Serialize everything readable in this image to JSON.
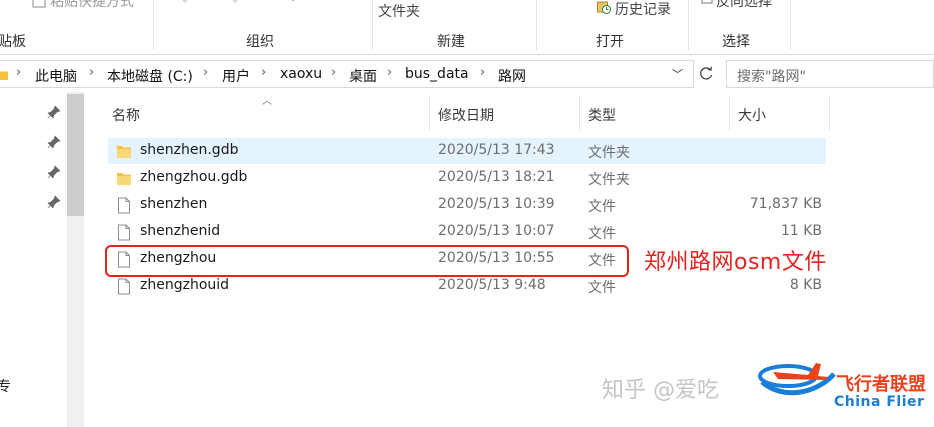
{
  "ribbon": {
    "clipboard_cut_label": "粘贴快捷方式",
    "clipboard_group": "贴板",
    "organize_group": "组织",
    "new_folder_cut_label": "文件夹",
    "new_group": "新建",
    "history_label": "历史记录",
    "open_group": "打开",
    "invert_selection_cut_label": "反向选择",
    "select_group": "选择"
  },
  "address": {
    "breadcrumbs": [
      "此电脑",
      "本地磁盘 (C:)",
      "用户",
      "xaoxu",
      "桌面",
      "bus_data",
      "路网"
    ]
  },
  "search": {
    "placeholder": "搜索\"路网\""
  },
  "nav": {
    "partial_label": "专"
  },
  "columns": {
    "name": "名称",
    "date": "修改日期",
    "type": "类型",
    "size": "大小"
  },
  "files": [
    {
      "name": "shenzhen.gdb",
      "date": "2020/5/13 17:43",
      "type": "文件夹",
      "size": "",
      "icon": "folder-icon"
    },
    {
      "name": "zhengzhou.gdb",
      "date": "2020/5/13 18:21",
      "type": "文件夹",
      "size": "",
      "icon": "folder-icon"
    },
    {
      "name": "shenzhen",
      "date": "2020/5/13 10:39",
      "type": "文件",
      "size": "71,837 KB",
      "icon": "file-icon"
    },
    {
      "name": "shenzhenid",
      "date": "2020/5/13 10:07",
      "type": "文件",
      "size": "11 KB",
      "icon": "file-icon"
    },
    {
      "name": "zhengzhou",
      "date": "2020/5/13 10:55",
      "type": "文件",
      "size": "",
      "icon": "file-icon"
    },
    {
      "name": "zhengzhouid",
      "date": "2020/5/13 9:48",
      "type": "文件",
      "size": "8 KB",
      "icon": "file-icon"
    }
  ],
  "selected_row": 0,
  "annotation": {
    "text": "郑州路网osm文件",
    "color": "#e4231f"
  },
  "watermark": {
    "text": "知乎 @爱吃",
    "brand": "飞行者联盟",
    "brand_en": "China Flier"
  },
  "colors": {
    "selection": "#e5f3ff",
    "folder": "#f4c23d",
    "accent": "#e4231f"
  }
}
